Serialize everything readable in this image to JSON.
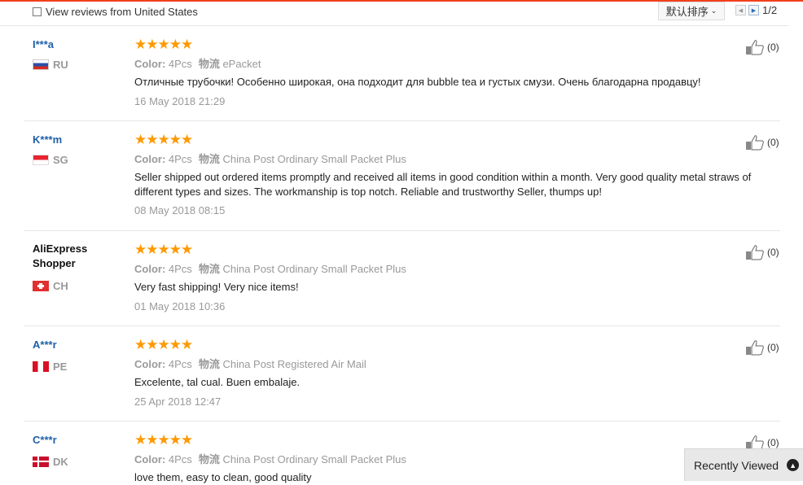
{
  "toolbar": {
    "filter_label": "View reviews from United States",
    "sort_label": "默认排序",
    "page_indicator": "1/2"
  },
  "reviews": [
    {
      "user": "I***a",
      "country": "RU",
      "stars": "★★★★★",
      "color_label": "Color:",
      "color_value": "4Pcs",
      "shipping_label": "物流",
      "shipping_value": "ePacket",
      "text": "Отличные трубочки! Особенно широкая, она подходит для bubble tea и густых смузи. Очень благодарна продавцу!",
      "date": "16 May 2018 21:29",
      "helpful": "(0)"
    },
    {
      "user": "K***m",
      "country": "SG",
      "stars": "★★★★★",
      "color_label": "Color:",
      "color_value": "4Pcs",
      "shipping_label": "物流",
      "shipping_value": "China Post Ordinary Small Packet Plus",
      "text": "Seller shipped out ordered items promptly and received all items in good condition within a month. Very good quality metal straws of different types and sizes. The workmanship is top notch. Reliable and trustworthy Seller, thumps up!",
      "date": "08 May 2018 08:15",
      "helpful": "(0)"
    },
    {
      "user": "AliExpress Shopper",
      "country": "CH",
      "stars": "★★★★★",
      "color_label": "Color:",
      "color_value": "4Pcs",
      "shipping_label": "物流",
      "shipping_value": "China Post Ordinary Small Packet Plus",
      "text": "Very fast shipping! Very nice items!",
      "date": "01 May 2018 10:36",
      "helpful": "(0)"
    },
    {
      "user": "A***r",
      "country": "PE",
      "stars": "★★★★★",
      "color_label": "Color:",
      "color_value": "4Pcs",
      "shipping_label": "物流",
      "shipping_value": "China Post Registered Air Mail",
      "text": "Excelente, tal cual. Buen embalaje.",
      "date": "25 Apr 2018 12:47",
      "helpful": "(0)"
    },
    {
      "user": "C***r",
      "country": "DK",
      "stars": "★★★★★",
      "color_label": "Color:",
      "color_value": "4Pcs",
      "shipping_label": "物流",
      "shipping_value": "China Post Ordinary Small Packet Plus",
      "text": "love them, easy to clean, good quality",
      "date": "",
      "helpful": "(0)"
    }
  ],
  "recently_viewed": {
    "label": "Recently Viewed"
  },
  "colors": {
    "accent": "#f2401d",
    "star": "#ff9900",
    "username": "#1f5fa8"
  }
}
